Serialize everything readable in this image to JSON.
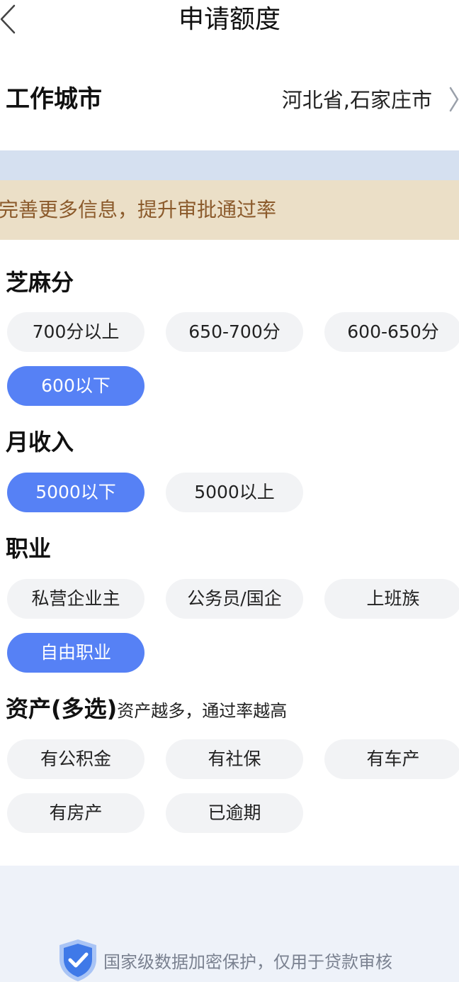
{
  "header": {
    "title": "申请额度",
    "back_icon": "chevron-left-icon"
  },
  "city": {
    "label": "工作城市",
    "value": "河北省,石家庄市",
    "arrow_icon": "chevron-right-icon"
  },
  "tip": {
    "text": "完善更多信息，提升审批通过率"
  },
  "sesame": {
    "title": "芝麻分",
    "options": [
      "700分以上",
      "650-700分",
      "600-650分",
      "600以下"
    ],
    "selected": "600以下"
  },
  "income": {
    "title": "月收入",
    "options": [
      "5000以下",
      "5000以上"
    ],
    "selected": "5000以下"
  },
  "job": {
    "title": "职业",
    "options": [
      "私营企业主",
      "公务员/国企",
      "上班族",
      "自由职业"
    ],
    "selected": "自由职业"
  },
  "assets": {
    "title": "资产(多选)",
    "subtitle": "资产越多，通过率越高",
    "options": [
      "有公积金",
      "有社保",
      "有车产",
      "有房产",
      "已逾期"
    ],
    "selected": []
  },
  "footer": {
    "text": "国家级数据加密保护，仅用于贷款审核",
    "icon": "shield-check-icon"
  },
  "colors": {
    "accent": "#5681f5",
    "chip_bg": "#f2f3f5",
    "tip_bg": "#ebdfc7",
    "tip_text": "#8b5a2b",
    "band_blue": "#d5e0f0",
    "footer_bg": "#eef2f9"
  }
}
